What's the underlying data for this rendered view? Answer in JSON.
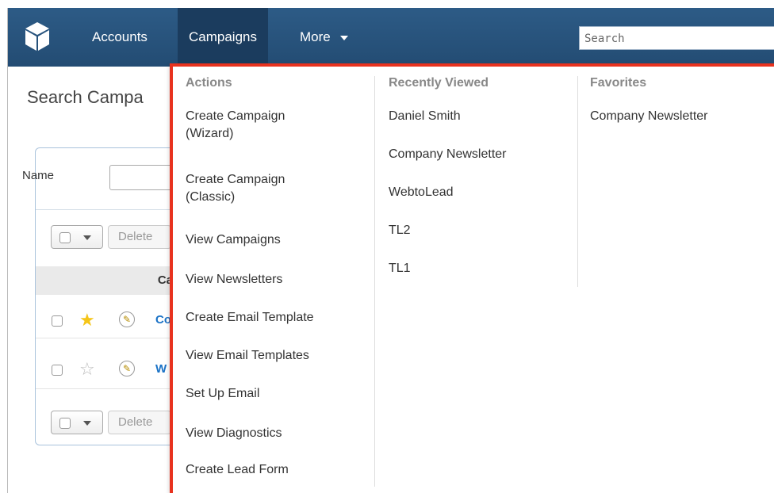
{
  "navbar": {
    "items": [
      {
        "label": "Accounts"
      },
      {
        "label": "Campaigns"
      },
      {
        "label": "More"
      }
    ],
    "search_placeholder": "Search"
  },
  "page": {
    "title": "Search Campa",
    "name_label": "Name",
    "delete_label": "Delete",
    "column_header_partial": "Ca",
    "rows": [
      {
        "starred": true,
        "link_partial": "Co"
      },
      {
        "starred": false,
        "link_partial": "W"
      }
    ]
  },
  "dropdown": {
    "actions": {
      "heading": "Actions",
      "items": [
        {
          "line1": "Create Campaign",
          "line2": "(Wizard)"
        },
        {
          "line1": "Create Campaign",
          "line2": "(Classic)"
        },
        {
          "line1": "View Campaigns"
        },
        {
          "line1": "View Newsletters"
        },
        {
          "line1": "Create Email Template"
        },
        {
          "line1": "View Email Templates"
        },
        {
          "line1": "Set Up Email"
        },
        {
          "line1": "View Diagnostics"
        },
        {
          "line1": "Create Lead Form"
        }
      ]
    },
    "recent": {
      "heading": "Recently Viewed",
      "items": [
        "Daniel Smith",
        "Company Newsletter",
        "WebtoLead",
        "TL2",
        "TL1"
      ]
    },
    "favorites": {
      "heading": "Favorites",
      "items": [
        "Company Newsletter"
      ]
    }
  },
  "colors": {
    "navbar": "#2d5b86",
    "active_tab": "#1b3c5e",
    "highlight_border": "#e8321e",
    "link": "#1a72c6"
  }
}
